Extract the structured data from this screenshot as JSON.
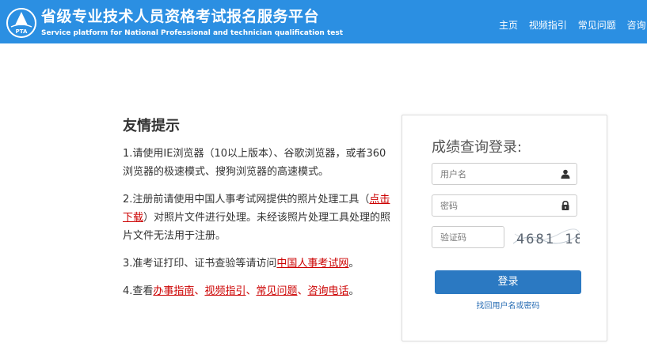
{
  "header": {
    "title_cn": "省级专业技术人员资格考试报名服务平台",
    "title_en": "Service platform for National Professional and technician qualification test",
    "logo_text": "PTA",
    "bg_color": "#2b8fe2",
    "nav": [
      {
        "label": "主页"
      },
      {
        "label": "视频指引"
      },
      {
        "label": "常见问题"
      },
      {
        "label": "咨询电话"
      }
    ]
  },
  "notice": {
    "title": "友情提示",
    "item1": "1.请使用IE浏览器（10以上版本）、谷歌浏览器，或者360浏览器的极速模式、搜狗浏览器的高速模式。",
    "item2_prefix": "2.注册前请使用中国人事考试网提供的照片处理工具（",
    "item2_link": "点击下载",
    "item2_suffix": "）对照片文件进行处理。未经该照片处理工具处理的照片文件无法用于注册。",
    "item3_prefix": "3.准考证打印、证书查验等请访问",
    "item3_link": "中国人事考试网",
    "item3_suffix": "。",
    "item4_prefix": "4.查看",
    "item4_links": [
      "办事指南",
      "视频指引",
      "常见问题",
      "咨询电话"
    ],
    "item4_sep": "、",
    "item4_suffix": "。"
  },
  "login": {
    "title": "成绩查询登录:",
    "username_placeholder": "用户名",
    "password_placeholder": "密码",
    "captcha_placeholder": "验证码",
    "captcha_text": "4681 18",
    "login_button": "登录",
    "forgot_link": "找回用户名或密码",
    "button_color": "#2b79c2"
  }
}
